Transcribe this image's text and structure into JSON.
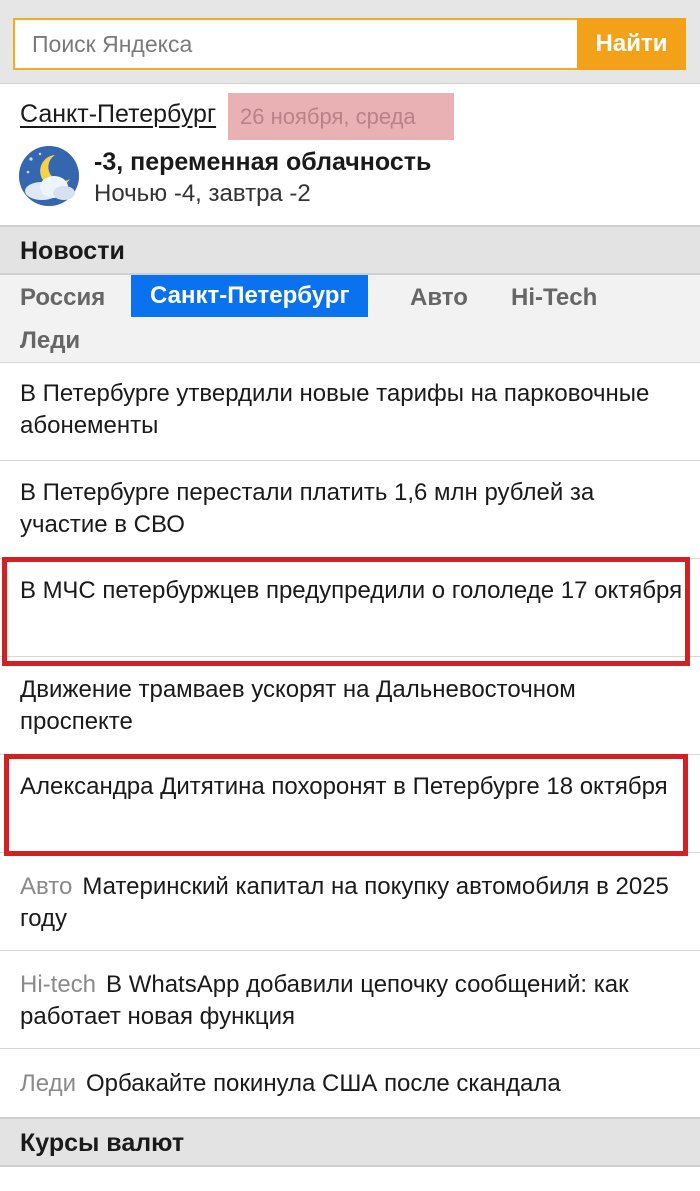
{
  "search": {
    "placeholder": "Поиск Яндекса",
    "button_label": "Найти"
  },
  "weather": {
    "city": "Санкт-Петербург",
    "date": "26 ноября, среда",
    "icon": "night-partly-cloudy-icon",
    "current": "-3, переменная облачность",
    "forecast": "Ночью -4, завтра -2"
  },
  "news": {
    "title": "Новости",
    "tabs": [
      "Россия",
      "Санкт-Петербург",
      "Авто",
      "Hi-Tech",
      "Леди"
    ],
    "active_tab": "Санкт-Петербург",
    "items": [
      {
        "text": "В Петербурге утвердили новые тарифы на парковочные абонементы"
      },
      {
        "text": "В Петербурге перестали платить 1,6 млн рублей за участие в СВО"
      },
      {
        "text": "В МЧС петербуржцев предупредили о гололеде 17 октября",
        "highlighted": true
      },
      {
        "text": "Движение трамваев ускорят на Дальневосточном проспекте"
      },
      {
        "text": "Александра Дитятина похоронят в Петербурге 18 октября",
        "highlighted": true
      },
      {
        "tag": "Авто",
        "text": "Материнский капитал на покупку автомобиля в 2025 году"
      },
      {
        "tag": "Hi-tech",
        "text": "В WhatsApp добавили цепочку сообщений: как работает новая функция"
      },
      {
        "tag": "Леди",
        "text": "Орбакайте покинула США после скандала"
      }
    ]
  },
  "rates": {
    "title": "Курсы валют"
  },
  "colors": {
    "accent": "#f4a11a",
    "active_tab": "#0a72ee",
    "highlight_frame": "#d32024",
    "date_highlight": "#e9b1b3"
  }
}
